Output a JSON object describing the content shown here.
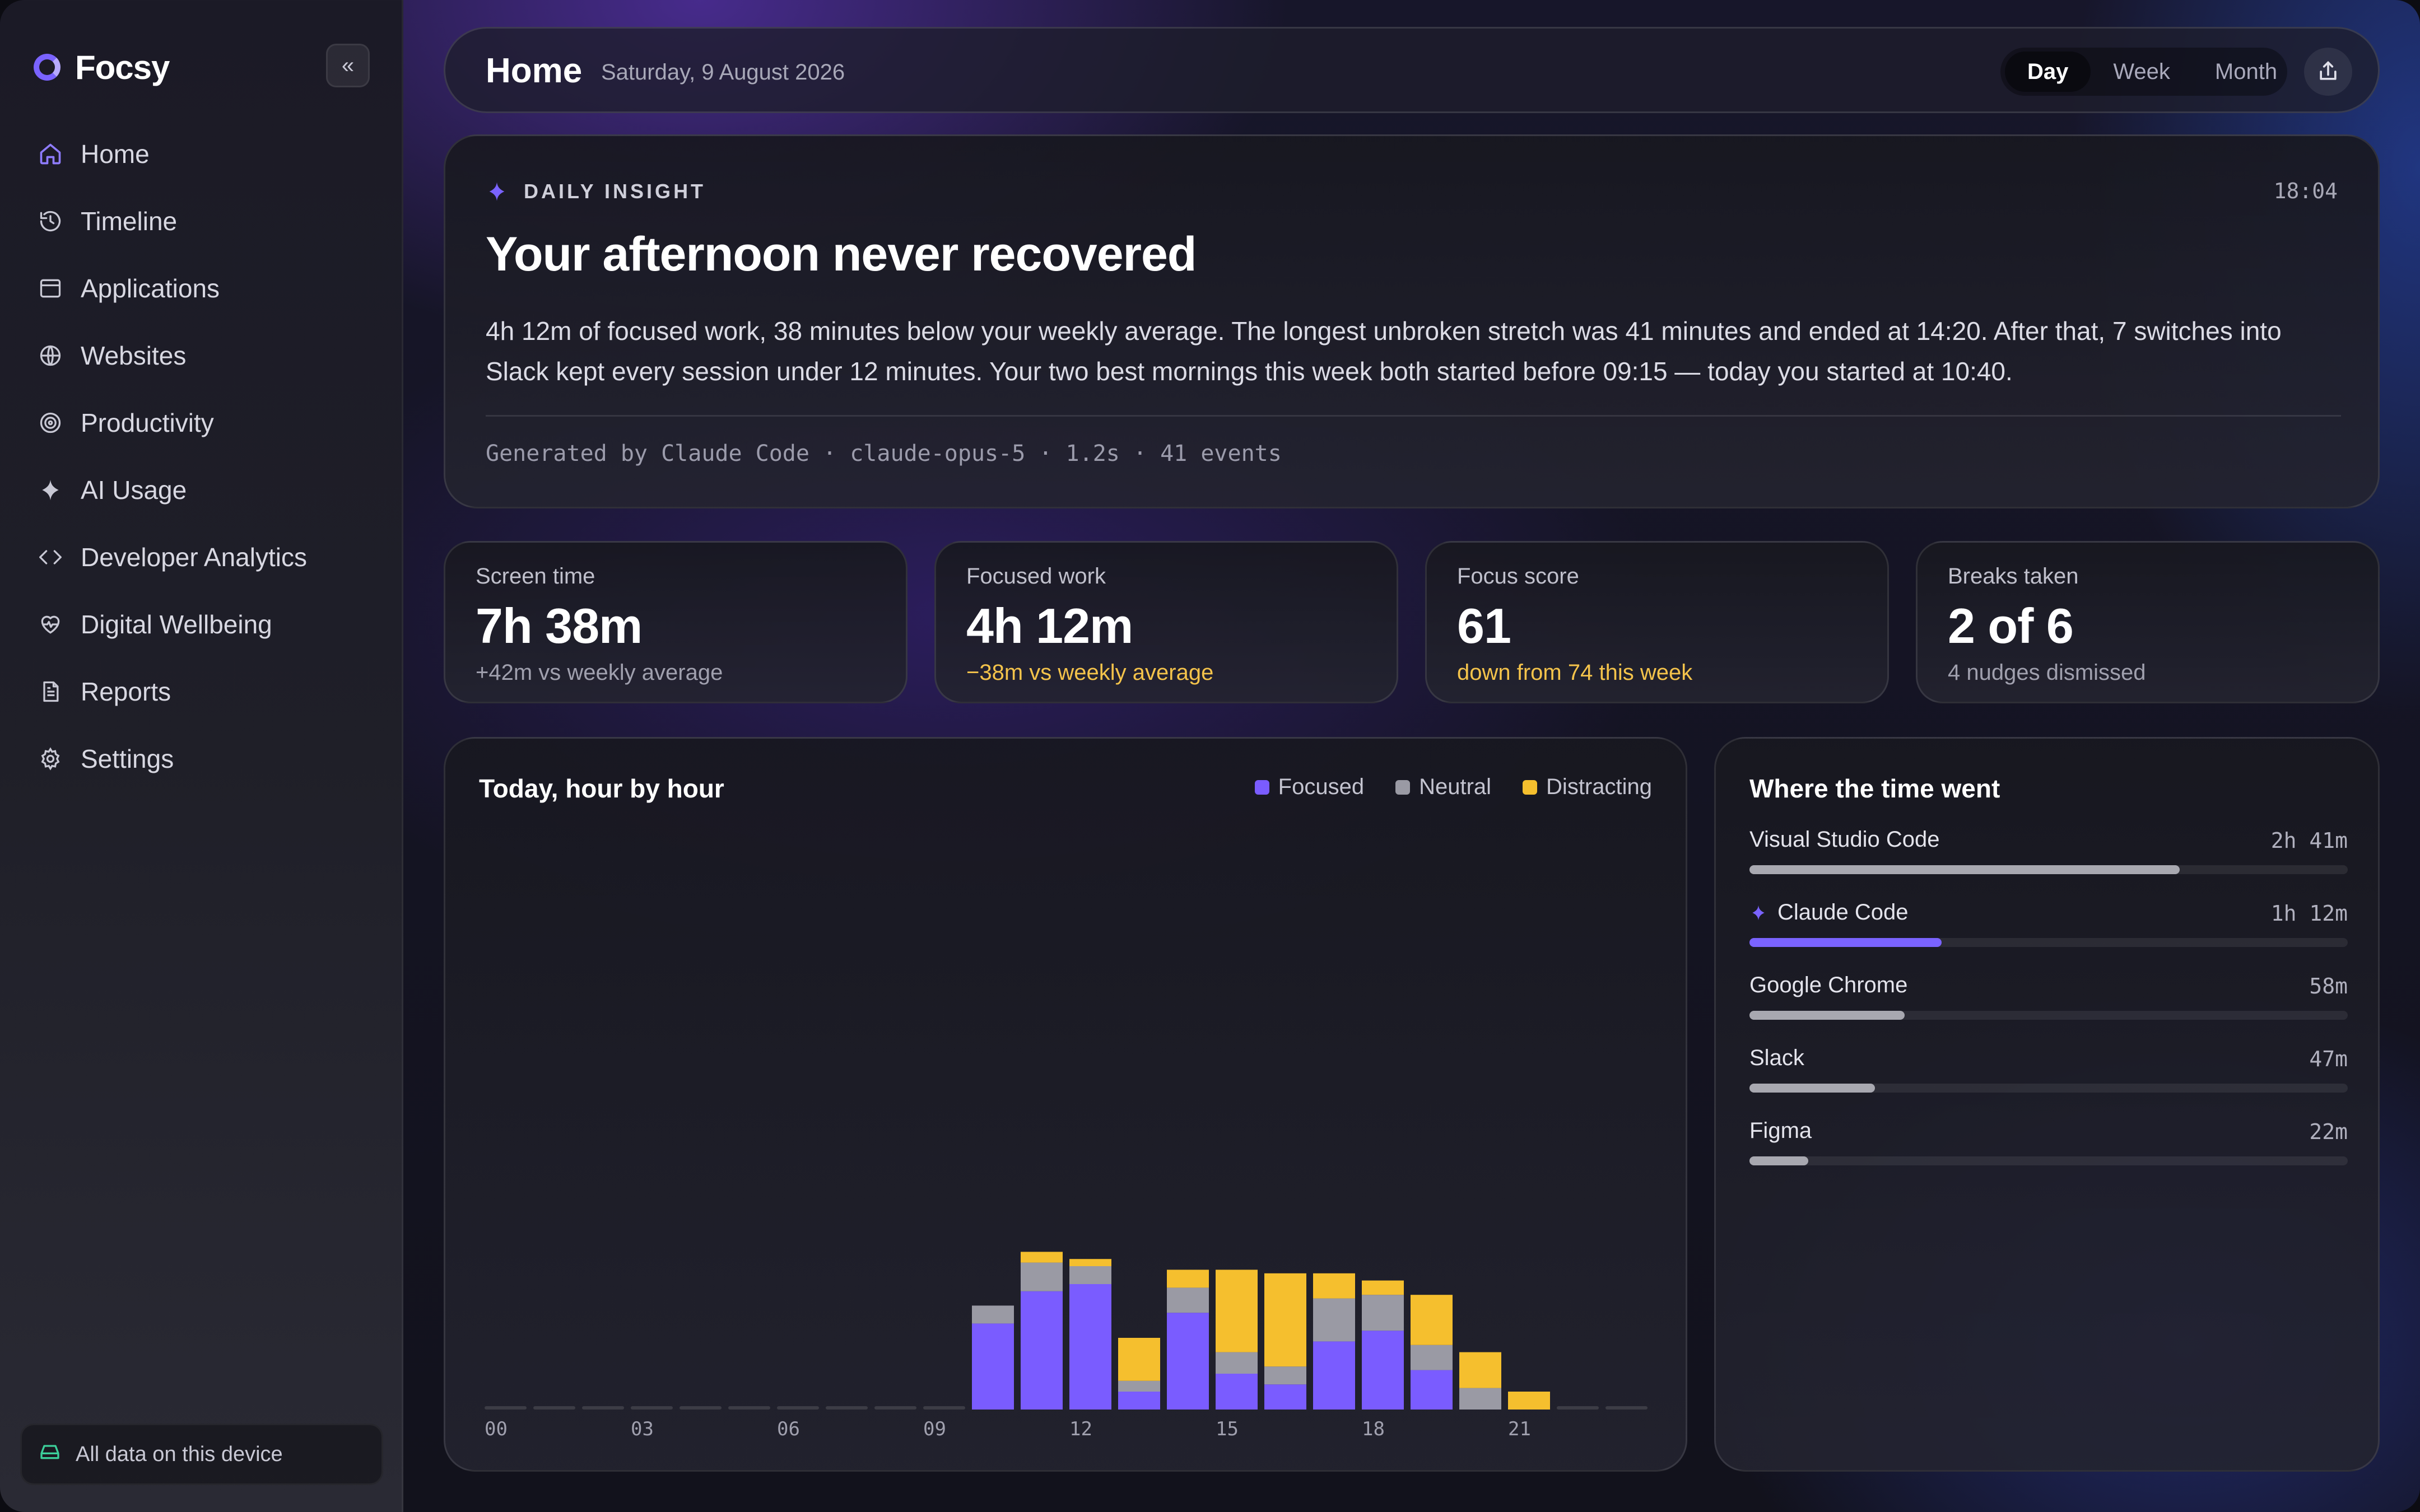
{
  "app": {
    "name": "Focsy"
  },
  "sidebar": {
    "items": [
      {
        "label": "Home",
        "icon": "home-icon",
        "active": true
      },
      {
        "label": "Timeline",
        "icon": "history-icon",
        "active": false
      },
      {
        "label": "Applications",
        "icon": "window-icon",
        "active": false
      },
      {
        "label": "Websites",
        "icon": "globe-icon",
        "active": false
      },
      {
        "label": "Productivity",
        "icon": "target-icon",
        "active": false
      },
      {
        "label": "AI Usage",
        "icon": "sparkle-icon",
        "active": false
      },
      {
        "label": "Developer Analytics",
        "icon": "code-icon",
        "active": false
      },
      {
        "label": "Digital Wellbeing",
        "icon": "heart-pulse-icon",
        "active": false
      },
      {
        "label": "Reports",
        "icon": "document-icon",
        "active": false
      },
      {
        "label": "Settings",
        "icon": "gear-icon",
        "active": false
      }
    ],
    "footer": "All data on this device"
  },
  "header": {
    "title": "Home",
    "date": "Saturday, 9 August 2026",
    "ranges": [
      "Day",
      "Week",
      "Month"
    ],
    "active_range": "Day"
  },
  "insight": {
    "tag": "DAILY INSIGHT",
    "time": "18:04",
    "title": "Your afternoon never recovered",
    "body": "4h 12m of focused work, 38 minutes below your weekly average. The longest unbroken stretch was 41 minutes and ended at 14:20. After that, 7 switches into Slack kept every session under 12 minutes. Your two best mornings this week both started before 09:15 — today you started at 10:40.",
    "meta": "Generated by Claude Code · claude-opus-5 · 1.2s · 41 events"
  },
  "stats": [
    {
      "label": "Screen time",
      "value": "7h 38m",
      "sub": "+42m vs weekly average",
      "tone": "neutral"
    },
    {
      "label": "Focused work",
      "value": "4h 12m",
      "sub": "−38m vs weekly average",
      "tone": "warn"
    },
    {
      "label": "Focus score",
      "value": "61",
      "sub": "down from 74 this week",
      "tone": "warn"
    },
    {
      "label": "Breaks taken",
      "value": "2 of 6",
      "sub": "4 nudges dismissed",
      "tone": "neutral"
    }
  ],
  "colors": {
    "accent": "#7a63ff",
    "focused": "#7a5cff",
    "neutral": "#9a9aa4",
    "distracting": "#f5bf2e"
  },
  "chart_data": {
    "type": "bar",
    "stacked": true,
    "title": "Today, hour by hour",
    "x_unit": "hour",
    "x": [
      0,
      1,
      2,
      3,
      4,
      5,
      6,
      7,
      8,
      9,
      10,
      11,
      12,
      13,
      14,
      15,
      16,
      17,
      18,
      19,
      20,
      21,
      22,
      23
    ],
    "x_tick_labels": [
      "00",
      "03",
      "06",
      "09",
      "12",
      "15",
      "18",
      "21"
    ],
    "x_tick_positions": [
      0,
      3,
      6,
      9,
      12,
      15,
      18,
      21
    ],
    "y_unit": "minutes",
    "ylim": [
      0,
      60
    ],
    "grid": false,
    "legend_position": "top-right",
    "series": [
      {
        "name": "Focused",
        "color": "#7a5cff",
        "values": [
          0,
          0,
          0,
          0,
          0,
          0,
          0,
          0,
          0,
          0,
          24,
          33,
          35,
          5,
          27,
          10,
          7,
          19,
          22,
          11,
          0,
          0,
          0,
          0
        ]
      },
      {
        "name": "Neutral",
        "color": "#9a9aa4",
        "values": [
          0,
          0,
          0,
          0,
          0,
          0,
          0,
          0,
          0,
          0,
          5,
          8,
          5,
          3,
          7,
          6,
          5,
          12,
          10,
          7,
          6,
          0,
          0,
          0
        ]
      },
      {
        "name": "Distracting",
        "color": "#f5bf2e",
        "values": [
          0,
          0,
          0,
          0,
          0,
          0,
          0,
          0,
          0,
          0,
          0,
          3,
          2,
          12,
          5,
          23,
          26,
          7,
          4,
          14,
          10,
          5,
          0,
          0
        ]
      }
    ]
  },
  "time_breakdown": {
    "title": "Where the time went",
    "apps": [
      {
        "name": "Visual Studio Code",
        "duration": "2h 41m",
        "minutes": 161,
        "ai": false
      },
      {
        "name": "Claude Code",
        "duration": "1h 12m",
        "minutes": 72,
        "ai": true
      },
      {
        "name": "Google Chrome",
        "duration": "58m",
        "minutes": 58,
        "ai": false
      },
      {
        "name": "Slack",
        "duration": "47m",
        "minutes": 47,
        "ai": false
      },
      {
        "name": "Figma",
        "duration": "22m",
        "minutes": 22,
        "ai": false
      }
    ],
    "scale_max_minutes": 224
  }
}
